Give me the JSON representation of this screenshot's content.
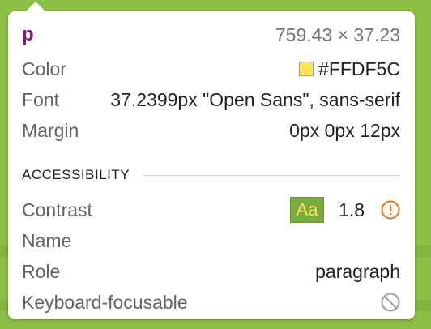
{
  "element": {
    "tag": "p",
    "dimensions": "759.43 × 37.23"
  },
  "properties": {
    "color": {
      "label": "Color",
      "value": "#FFDF5C",
      "swatch": "#FFDF5C"
    },
    "font": {
      "label": "Font",
      "value": "37.2399px \"Open Sans\", sans-serif"
    },
    "margin": {
      "label": "Margin",
      "value": "0px 0px 12px"
    }
  },
  "accessibility": {
    "title": "ACCESSIBILITY",
    "contrast": {
      "label": "Contrast",
      "badge": "Aa",
      "ratio": "1.8",
      "status_icon": "warning-circle-icon",
      "status_color": "#E8710A"
    },
    "name": {
      "label": "Name",
      "value": ""
    },
    "role": {
      "label": "Role",
      "value": "paragraph"
    },
    "keyboard_focusable": {
      "label": "Keyboard-focusable",
      "icon": "not-allowed-icon"
    }
  },
  "colors": {
    "page_background": "#8CBF45",
    "tag_color": "#881280",
    "badge_background": "#7AAB3C"
  }
}
